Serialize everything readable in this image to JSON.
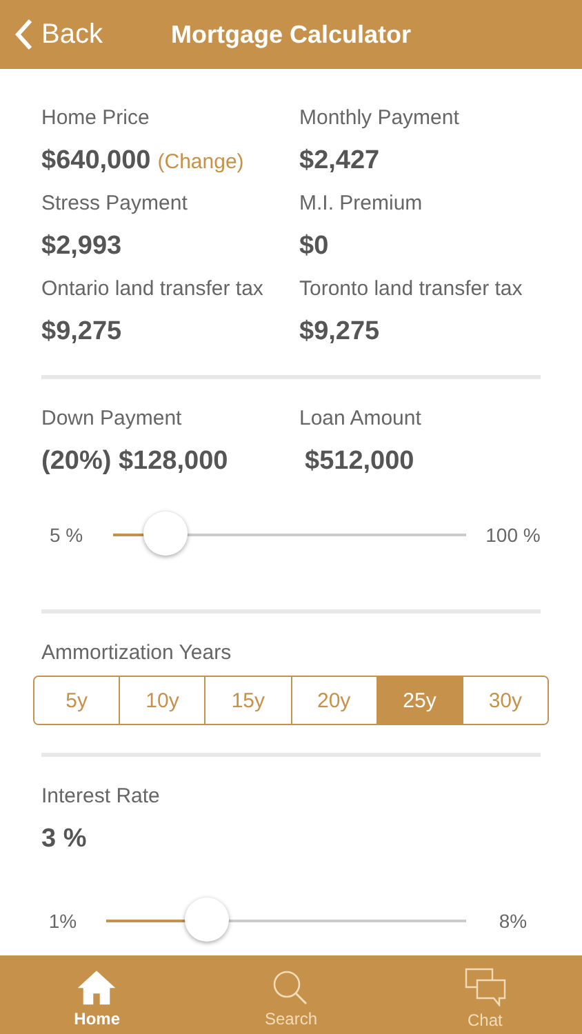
{
  "header": {
    "back": "Back",
    "title": "Mortgage Calculator"
  },
  "stats": [
    {
      "label": "Home Price",
      "value": "$640,000",
      "link": "(Change)"
    },
    {
      "label": "Monthly Payment",
      "value": "$2,427"
    },
    {
      "label": "Stress Payment",
      "value": "$2,993"
    },
    {
      "label": "M.I. Premium",
      "value": "$0"
    },
    {
      "label": "Ontario land transfer tax",
      "value": "$9,275"
    },
    {
      "label": "Toronto land transfer tax",
      "value": "$9,275"
    }
  ],
  "down_payment": {
    "label": "Down Payment",
    "value": "(20%) $128,000"
  },
  "loan": {
    "label": "Loan Amount",
    "value": "$512,000"
  },
  "down_slider": {
    "min": "5 %",
    "max": "100 %",
    "level": 0.15
  },
  "amortization": {
    "label": "Ammortization Years",
    "options": [
      {
        "label": "5y",
        "selected": false
      },
      {
        "label": "10y",
        "selected": false
      },
      {
        "label": "15y",
        "selected": false
      },
      {
        "label": "20y",
        "selected": false
      },
      {
        "label": "25y",
        "selected": true
      },
      {
        "label": "30y",
        "selected": false
      }
    ]
  },
  "interest": {
    "label": "Interest Rate",
    "value": "3 %"
  },
  "interest_slider": {
    "min": "1%",
    "max": "8%",
    "level": 0.28
  },
  "tabs": [
    {
      "kind": "home",
      "label": "Home",
      "selected": true
    },
    {
      "kind": "search",
      "label": "Search",
      "selected": false
    },
    {
      "kind": "chat",
      "label": "Chat",
      "selected": false
    }
  ]
}
